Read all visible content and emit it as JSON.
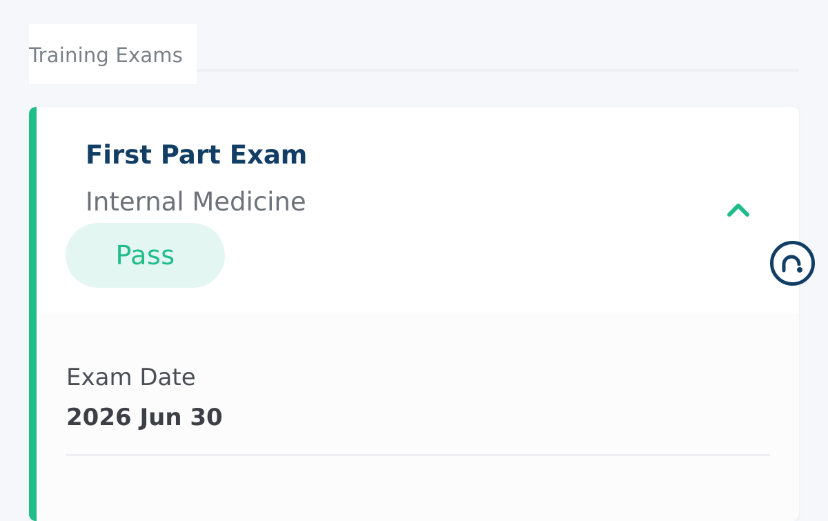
{
  "tabs": {
    "active_label": "Training Exams"
  },
  "exam_card": {
    "title": "First Part Exam",
    "specialty": "Internal Medicine",
    "status": "Pass",
    "details": [
      {
        "label": "Exam Date",
        "value": "2026 Jun 30"
      }
    ]
  },
  "icons": {
    "collapse": "chevron-up-icon",
    "help": "chat-help-icon"
  },
  "colors": {
    "accent": "#1fbd87",
    "title": "#123e66",
    "badge_bg": "#e4f6f1",
    "background": "#f6f7fb",
    "icon_dark": "#123e66"
  }
}
